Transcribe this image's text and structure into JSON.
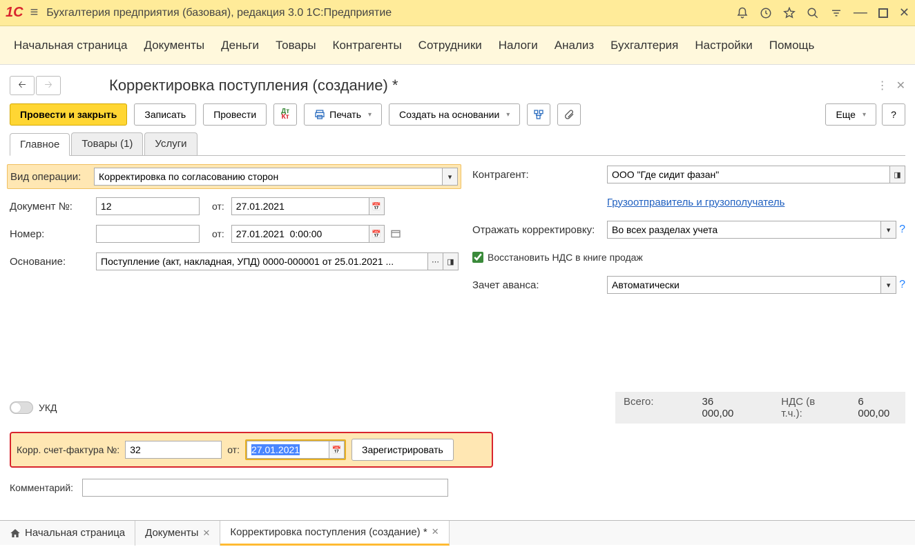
{
  "header": {
    "app_title": "Бухгалтерия предприятия (базовая), редакция 3.0 1С:Предприятие"
  },
  "main_menu": [
    "Начальная страница",
    "Документы",
    "Деньги",
    "Товары",
    "Контрагенты",
    "Сотрудники",
    "Налоги",
    "Анализ",
    "Бухгалтерия",
    "Настройки",
    "Помощь"
  ],
  "doc": {
    "title": "Корректировка поступления (создание) *"
  },
  "toolbar": {
    "post_and_close": "Провести и закрыть",
    "save": "Записать",
    "post": "Провести",
    "print": "Печать",
    "create_based": "Создать на основании",
    "more": "Еще",
    "help": "?"
  },
  "tabs": {
    "main": "Главное",
    "goods": "Товары (1)",
    "services": "Услуги"
  },
  "form": {
    "operation_type_label": "Вид операции:",
    "operation_type_value": "Корректировка по согласованию сторон",
    "doc_no_label": "Документ №:",
    "doc_no_value": "12",
    "from_label": "от:",
    "doc_date_value": "27.01.2021",
    "number_label": "Номер:",
    "number_value": "",
    "number_date_value": "27.01.2021  0:00:00",
    "basis_label": "Основание:",
    "basis_value": "Поступление (акт, накладная, УПД) 0000-000001 от 25.01.2021 ...",
    "contractor_label": "Контрагент:",
    "contractor_value": "ООО \"Где сидит фазан\"",
    "shipper_link": "Грузоотправитель и грузополучатель",
    "reflect_label": "Отражать корректировку:",
    "reflect_value": "Во всех разделах учета",
    "restore_vat_label": "Восстановить НДС в книге продаж",
    "advance_label": "Зачет аванса:",
    "advance_value": "Автоматически",
    "ukd_label": "УКД"
  },
  "totals": {
    "total_label": "Всего:",
    "total_value": "36 000,00",
    "vat_label": "НДС (в т.ч.):",
    "vat_value": "6 000,00"
  },
  "invoice": {
    "label": "Корр. счет-фактура №:",
    "number": "32",
    "from_label": "от:",
    "date": "27.01.2021",
    "register": "Зарегистрировать"
  },
  "comment": {
    "label": "Комментарий:",
    "value": ""
  },
  "bottom_tabs": {
    "home": "Начальная страница",
    "docs": "Документы",
    "current": "Корректировка поступления (создание) *"
  }
}
